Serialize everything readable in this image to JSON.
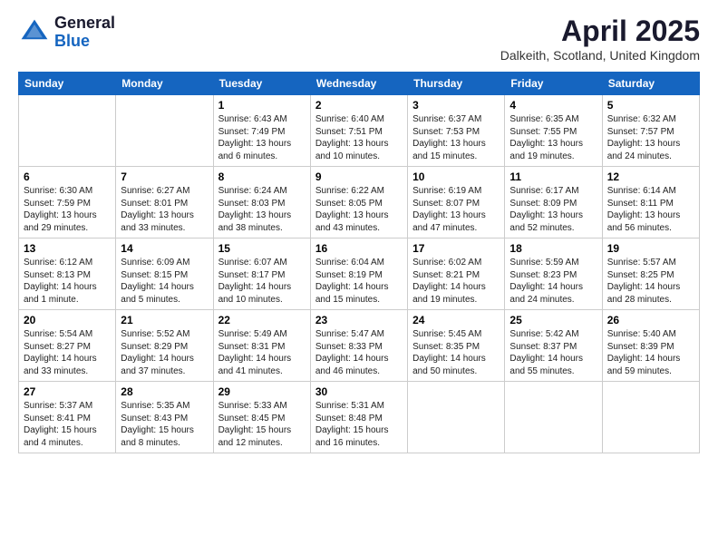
{
  "logo": {
    "general": "General",
    "blue": "Blue"
  },
  "title": "April 2025",
  "location": "Dalkeith, Scotland, United Kingdom",
  "days_of_week": [
    "Sunday",
    "Monday",
    "Tuesday",
    "Wednesday",
    "Thursday",
    "Friday",
    "Saturday"
  ],
  "weeks": [
    [
      {
        "day": "",
        "info": ""
      },
      {
        "day": "",
        "info": ""
      },
      {
        "day": "1",
        "info": "Sunrise: 6:43 AM\nSunset: 7:49 PM\nDaylight: 13 hours and 6 minutes."
      },
      {
        "day": "2",
        "info": "Sunrise: 6:40 AM\nSunset: 7:51 PM\nDaylight: 13 hours and 10 minutes."
      },
      {
        "day": "3",
        "info": "Sunrise: 6:37 AM\nSunset: 7:53 PM\nDaylight: 13 hours and 15 minutes."
      },
      {
        "day": "4",
        "info": "Sunrise: 6:35 AM\nSunset: 7:55 PM\nDaylight: 13 hours and 19 minutes."
      },
      {
        "day": "5",
        "info": "Sunrise: 6:32 AM\nSunset: 7:57 PM\nDaylight: 13 hours and 24 minutes."
      }
    ],
    [
      {
        "day": "6",
        "info": "Sunrise: 6:30 AM\nSunset: 7:59 PM\nDaylight: 13 hours and 29 minutes."
      },
      {
        "day": "7",
        "info": "Sunrise: 6:27 AM\nSunset: 8:01 PM\nDaylight: 13 hours and 33 minutes."
      },
      {
        "day": "8",
        "info": "Sunrise: 6:24 AM\nSunset: 8:03 PM\nDaylight: 13 hours and 38 minutes."
      },
      {
        "day": "9",
        "info": "Sunrise: 6:22 AM\nSunset: 8:05 PM\nDaylight: 13 hours and 43 minutes."
      },
      {
        "day": "10",
        "info": "Sunrise: 6:19 AM\nSunset: 8:07 PM\nDaylight: 13 hours and 47 minutes."
      },
      {
        "day": "11",
        "info": "Sunrise: 6:17 AM\nSunset: 8:09 PM\nDaylight: 13 hours and 52 minutes."
      },
      {
        "day": "12",
        "info": "Sunrise: 6:14 AM\nSunset: 8:11 PM\nDaylight: 13 hours and 56 minutes."
      }
    ],
    [
      {
        "day": "13",
        "info": "Sunrise: 6:12 AM\nSunset: 8:13 PM\nDaylight: 14 hours and 1 minute."
      },
      {
        "day": "14",
        "info": "Sunrise: 6:09 AM\nSunset: 8:15 PM\nDaylight: 14 hours and 5 minutes."
      },
      {
        "day": "15",
        "info": "Sunrise: 6:07 AM\nSunset: 8:17 PM\nDaylight: 14 hours and 10 minutes."
      },
      {
        "day": "16",
        "info": "Sunrise: 6:04 AM\nSunset: 8:19 PM\nDaylight: 14 hours and 15 minutes."
      },
      {
        "day": "17",
        "info": "Sunrise: 6:02 AM\nSunset: 8:21 PM\nDaylight: 14 hours and 19 minutes."
      },
      {
        "day": "18",
        "info": "Sunrise: 5:59 AM\nSunset: 8:23 PM\nDaylight: 14 hours and 24 minutes."
      },
      {
        "day": "19",
        "info": "Sunrise: 5:57 AM\nSunset: 8:25 PM\nDaylight: 14 hours and 28 minutes."
      }
    ],
    [
      {
        "day": "20",
        "info": "Sunrise: 5:54 AM\nSunset: 8:27 PM\nDaylight: 14 hours and 33 minutes."
      },
      {
        "day": "21",
        "info": "Sunrise: 5:52 AM\nSunset: 8:29 PM\nDaylight: 14 hours and 37 minutes."
      },
      {
        "day": "22",
        "info": "Sunrise: 5:49 AM\nSunset: 8:31 PM\nDaylight: 14 hours and 41 minutes."
      },
      {
        "day": "23",
        "info": "Sunrise: 5:47 AM\nSunset: 8:33 PM\nDaylight: 14 hours and 46 minutes."
      },
      {
        "day": "24",
        "info": "Sunrise: 5:45 AM\nSunset: 8:35 PM\nDaylight: 14 hours and 50 minutes."
      },
      {
        "day": "25",
        "info": "Sunrise: 5:42 AM\nSunset: 8:37 PM\nDaylight: 14 hours and 55 minutes."
      },
      {
        "day": "26",
        "info": "Sunrise: 5:40 AM\nSunset: 8:39 PM\nDaylight: 14 hours and 59 minutes."
      }
    ],
    [
      {
        "day": "27",
        "info": "Sunrise: 5:37 AM\nSunset: 8:41 PM\nDaylight: 15 hours and 4 minutes."
      },
      {
        "day": "28",
        "info": "Sunrise: 5:35 AM\nSunset: 8:43 PM\nDaylight: 15 hours and 8 minutes."
      },
      {
        "day": "29",
        "info": "Sunrise: 5:33 AM\nSunset: 8:45 PM\nDaylight: 15 hours and 12 minutes."
      },
      {
        "day": "30",
        "info": "Sunrise: 5:31 AM\nSunset: 8:48 PM\nDaylight: 15 hours and 16 minutes."
      },
      {
        "day": "",
        "info": ""
      },
      {
        "day": "",
        "info": ""
      },
      {
        "day": "",
        "info": ""
      }
    ]
  ]
}
